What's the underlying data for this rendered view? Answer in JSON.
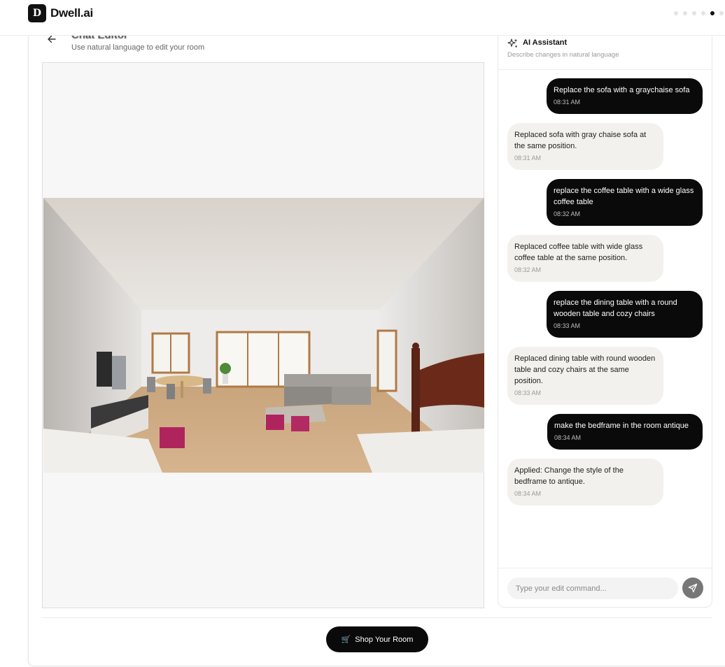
{
  "brand": {
    "logo_letter": "D",
    "name": "Dwell.ai"
  },
  "progress": {
    "total_steps": 6,
    "current_step": 5
  },
  "header": {
    "title": "Chat Editor",
    "subtitle": "Use natural language to edit your room"
  },
  "assistant": {
    "title": "AI Assistant",
    "subtitle": "Describe changes in natural language",
    "messages": [
      {
        "role": "user",
        "text": "Replace the sofa with a graychaise sofa",
        "time": "08:31 AM"
      },
      {
        "role": "bot",
        "text": "Replaced sofa with gray chaise sofa at the same position.",
        "time": "08:31 AM"
      },
      {
        "role": "user",
        "text": "replace the coffee table with a wide glass coffee table",
        "time": "08:32 AM"
      },
      {
        "role": "bot",
        "text": "Replaced coffee table with wide glass coffee table at the same position.",
        "time": "08:32 AM"
      },
      {
        "role": "user",
        "text": "replace the dining table with a round wooden table and cozy chairs",
        "time": "08:33 AM"
      },
      {
        "role": "bot",
        "text": "Replaced dining table with round wooden table and cozy chairs at the same position.",
        "time": "08:33 AM"
      },
      {
        "role": "user",
        "text": "make the bedframe in the room antique",
        "time": "08:34 AM"
      },
      {
        "role": "bot",
        "text": "Applied: Change the style of the bedframe to antique.",
        "time": "08:34 AM"
      }
    ],
    "input_placeholder": "Type your edit command...",
    "input_value": ""
  },
  "footer": {
    "shop_icon": "🛒",
    "shop_label": "Shop Your Room"
  },
  "colors": {
    "accent": "#0a0a0a",
    "bubble_bot": "#f3f1ee",
    "canvas_bg": "#f7f7f7"
  }
}
